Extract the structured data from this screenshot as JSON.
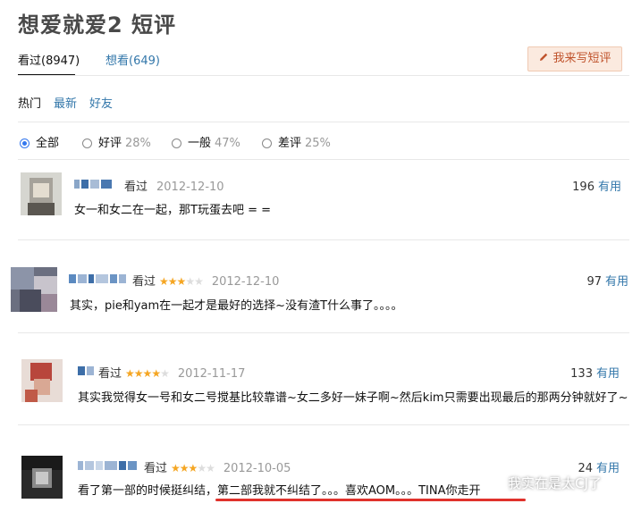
{
  "page_title": "想爱就爱2 短评",
  "tabs": {
    "active": "看过(8947)",
    "other": "想看(649)"
  },
  "write_button": "我来写短评",
  "sort": {
    "hot": "热门",
    "latest": "最新",
    "friends": "好友"
  },
  "filters": [
    {
      "label": "全部",
      "pct": "",
      "selected": true
    },
    {
      "label": "好评",
      "pct": "28%",
      "selected": false
    },
    {
      "label": "一般",
      "pct": "47%",
      "selected": false
    },
    {
      "label": "差评",
      "pct": "25%",
      "selected": false
    }
  ],
  "comments": [
    {
      "status": "看过",
      "stars": 0,
      "date": "2012-12-10",
      "votes": "196",
      "useful": "有用",
      "text": "女一和女二在一起，那T玩蛋去吧 = ="
    },
    {
      "status": "看过",
      "stars": 3,
      "date": "2012-12-10",
      "votes": "97",
      "useful": "有用",
      "text": "其实，pie和yam在一起才是最好的选择~没有渣T什么事了。。。。"
    },
    {
      "status": "看过",
      "stars": 4,
      "date": "2012-11-17",
      "votes": "133",
      "useful": "有用",
      "text": "其实我觉得女一号和女二号搅基比较靠谱~女二多好一妹子啊~然后kim只需要出现最后的那两分钟就好了~"
    },
    {
      "status": "看过",
      "stars": 3,
      "date": "2012-10-05",
      "votes": "24",
      "useful": "有用",
      "text": "看了第一部的时候挺纠结，第二部我就不纠结了。。。喜欢AOM。。。TINA你走开"
    }
  ],
  "watermark": "我实在是太CJ了",
  "colors": {
    "link": "#3377aa",
    "star": "#f5a623",
    "accent_button_bg": "#fbeadf",
    "accent_button_text": "#c0532c",
    "underline": "#e0322c"
  }
}
